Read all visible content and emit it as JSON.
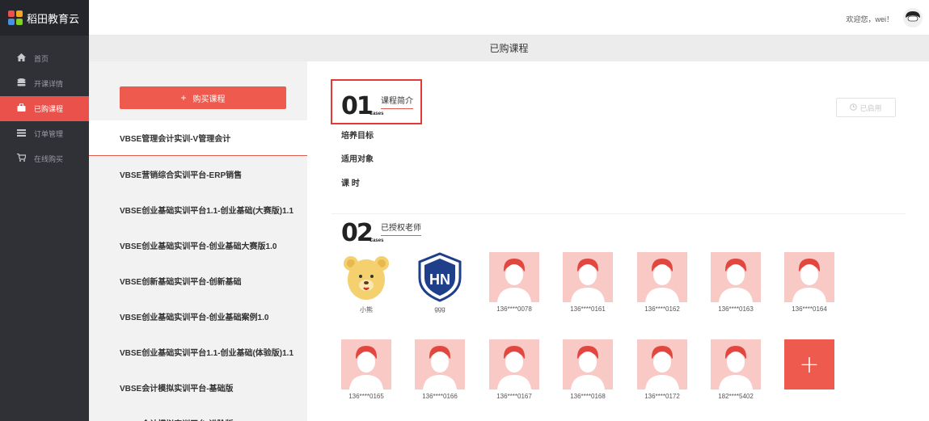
{
  "app": {
    "name": "稻田教育云",
    "colors": {
      "accent": "#ee5a4d",
      "sidebar": "#2f3137",
      "active_nav": "#e9514a"
    }
  },
  "sidebar": {
    "items": [
      {
        "label": "首页",
        "icon": "home-icon"
      },
      {
        "label": "开课详情",
        "icon": "database-icon"
      },
      {
        "label": "已购课程",
        "icon": "bag-icon",
        "active": true
      },
      {
        "label": "订单管理",
        "icon": "settings-icon"
      },
      {
        "label": "在线购买",
        "icon": "cart-icon"
      }
    ]
  },
  "header": {
    "welcome": "欢迎您，wei！"
  },
  "page": {
    "title": "已购课程"
  },
  "courses": {
    "buy_label": "购买课程",
    "items": [
      "VBSE管理会计实训-V管理会计",
      "VBSE营销综合实训平台-ERP销售",
      "VBSE创业基础实训平台1.1-创业基础(大赛版)1.1",
      "VBSE创业基础实训平台-创业基础大赛版1.0",
      "VBSE创新基础实训平台-创新基础",
      "VBSE创业基础实训平台-创业基础案例1.0",
      "VBSE创业基础实训平台1.1-创业基础(体验版)1.1",
      "VBSE会计模拟实训平台-基础版",
      "VBSE会计模拟实训平台-进阶版"
    ]
  },
  "section1": {
    "num": "01",
    "cases": "Cases",
    "title": "课程简介",
    "labels": [
      "培养目标",
      "适用对象",
      "课 时"
    ],
    "enabled_label": "已启用"
  },
  "section2": {
    "num": "02",
    "cases": "Cases",
    "title": "已授权老师",
    "teachers": [
      {
        "name": "小熊",
        "avatar": "bear"
      },
      {
        "name": "ggg",
        "avatar": "shield"
      },
      {
        "name": "136****0078",
        "avatar": "default"
      },
      {
        "name": "136****0161",
        "avatar": "default"
      },
      {
        "name": "136****0162",
        "avatar": "default"
      },
      {
        "name": "136****0163",
        "avatar": "default"
      },
      {
        "name": "136****0164",
        "avatar": "default"
      },
      {
        "name": "136****0165",
        "avatar": "default"
      },
      {
        "name": "136****0166",
        "avatar": "default"
      },
      {
        "name": "136****0167",
        "avatar": "default"
      },
      {
        "name": "136****0168",
        "avatar": "default"
      },
      {
        "name": "136****0172",
        "avatar": "default"
      },
      {
        "name": "182****5402",
        "avatar": "default"
      }
    ],
    "add_label": "+"
  }
}
